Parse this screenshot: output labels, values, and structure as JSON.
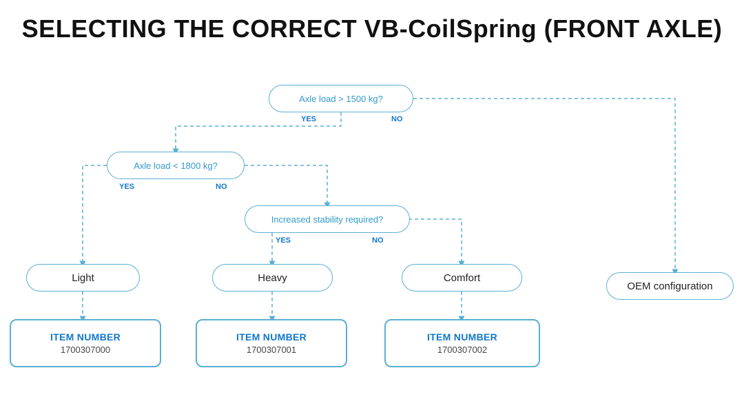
{
  "title": "SELECTING THE CORRECT VB-CoilSpring (FRONT AXLE)",
  "diagram": {
    "decisions": [
      {
        "id": "d1",
        "label": "Axle load > 1500 kg?",
        "yes_label": "YES",
        "no_label": "NO"
      },
      {
        "id": "d2",
        "label": "Axle load < 1800 kg?",
        "yes_label": "YES",
        "no_label": "NO"
      },
      {
        "id": "d3",
        "label": "Increased stability required?",
        "yes_label": "YES",
        "no_label": "NO"
      }
    ],
    "results": [
      {
        "id": "r1",
        "label": "Light"
      },
      {
        "id": "r2",
        "label": "Heavy"
      },
      {
        "id": "r3",
        "label": "Comfort"
      },
      {
        "id": "r4",
        "label": "OEM configuration"
      }
    ],
    "items": [
      {
        "id": "i1",
        "label": "ITEM NUMBER",
        "number": "1700307000"
      },
      {
        "id": "i2",
        "label": "ITEM NUMBER",
        "number": "1700307001"
      },
      {
        "id": "i3",
        "label": "ITEM NUMBER",
        "number": "1700307002"
      }
    ]
  }
}
